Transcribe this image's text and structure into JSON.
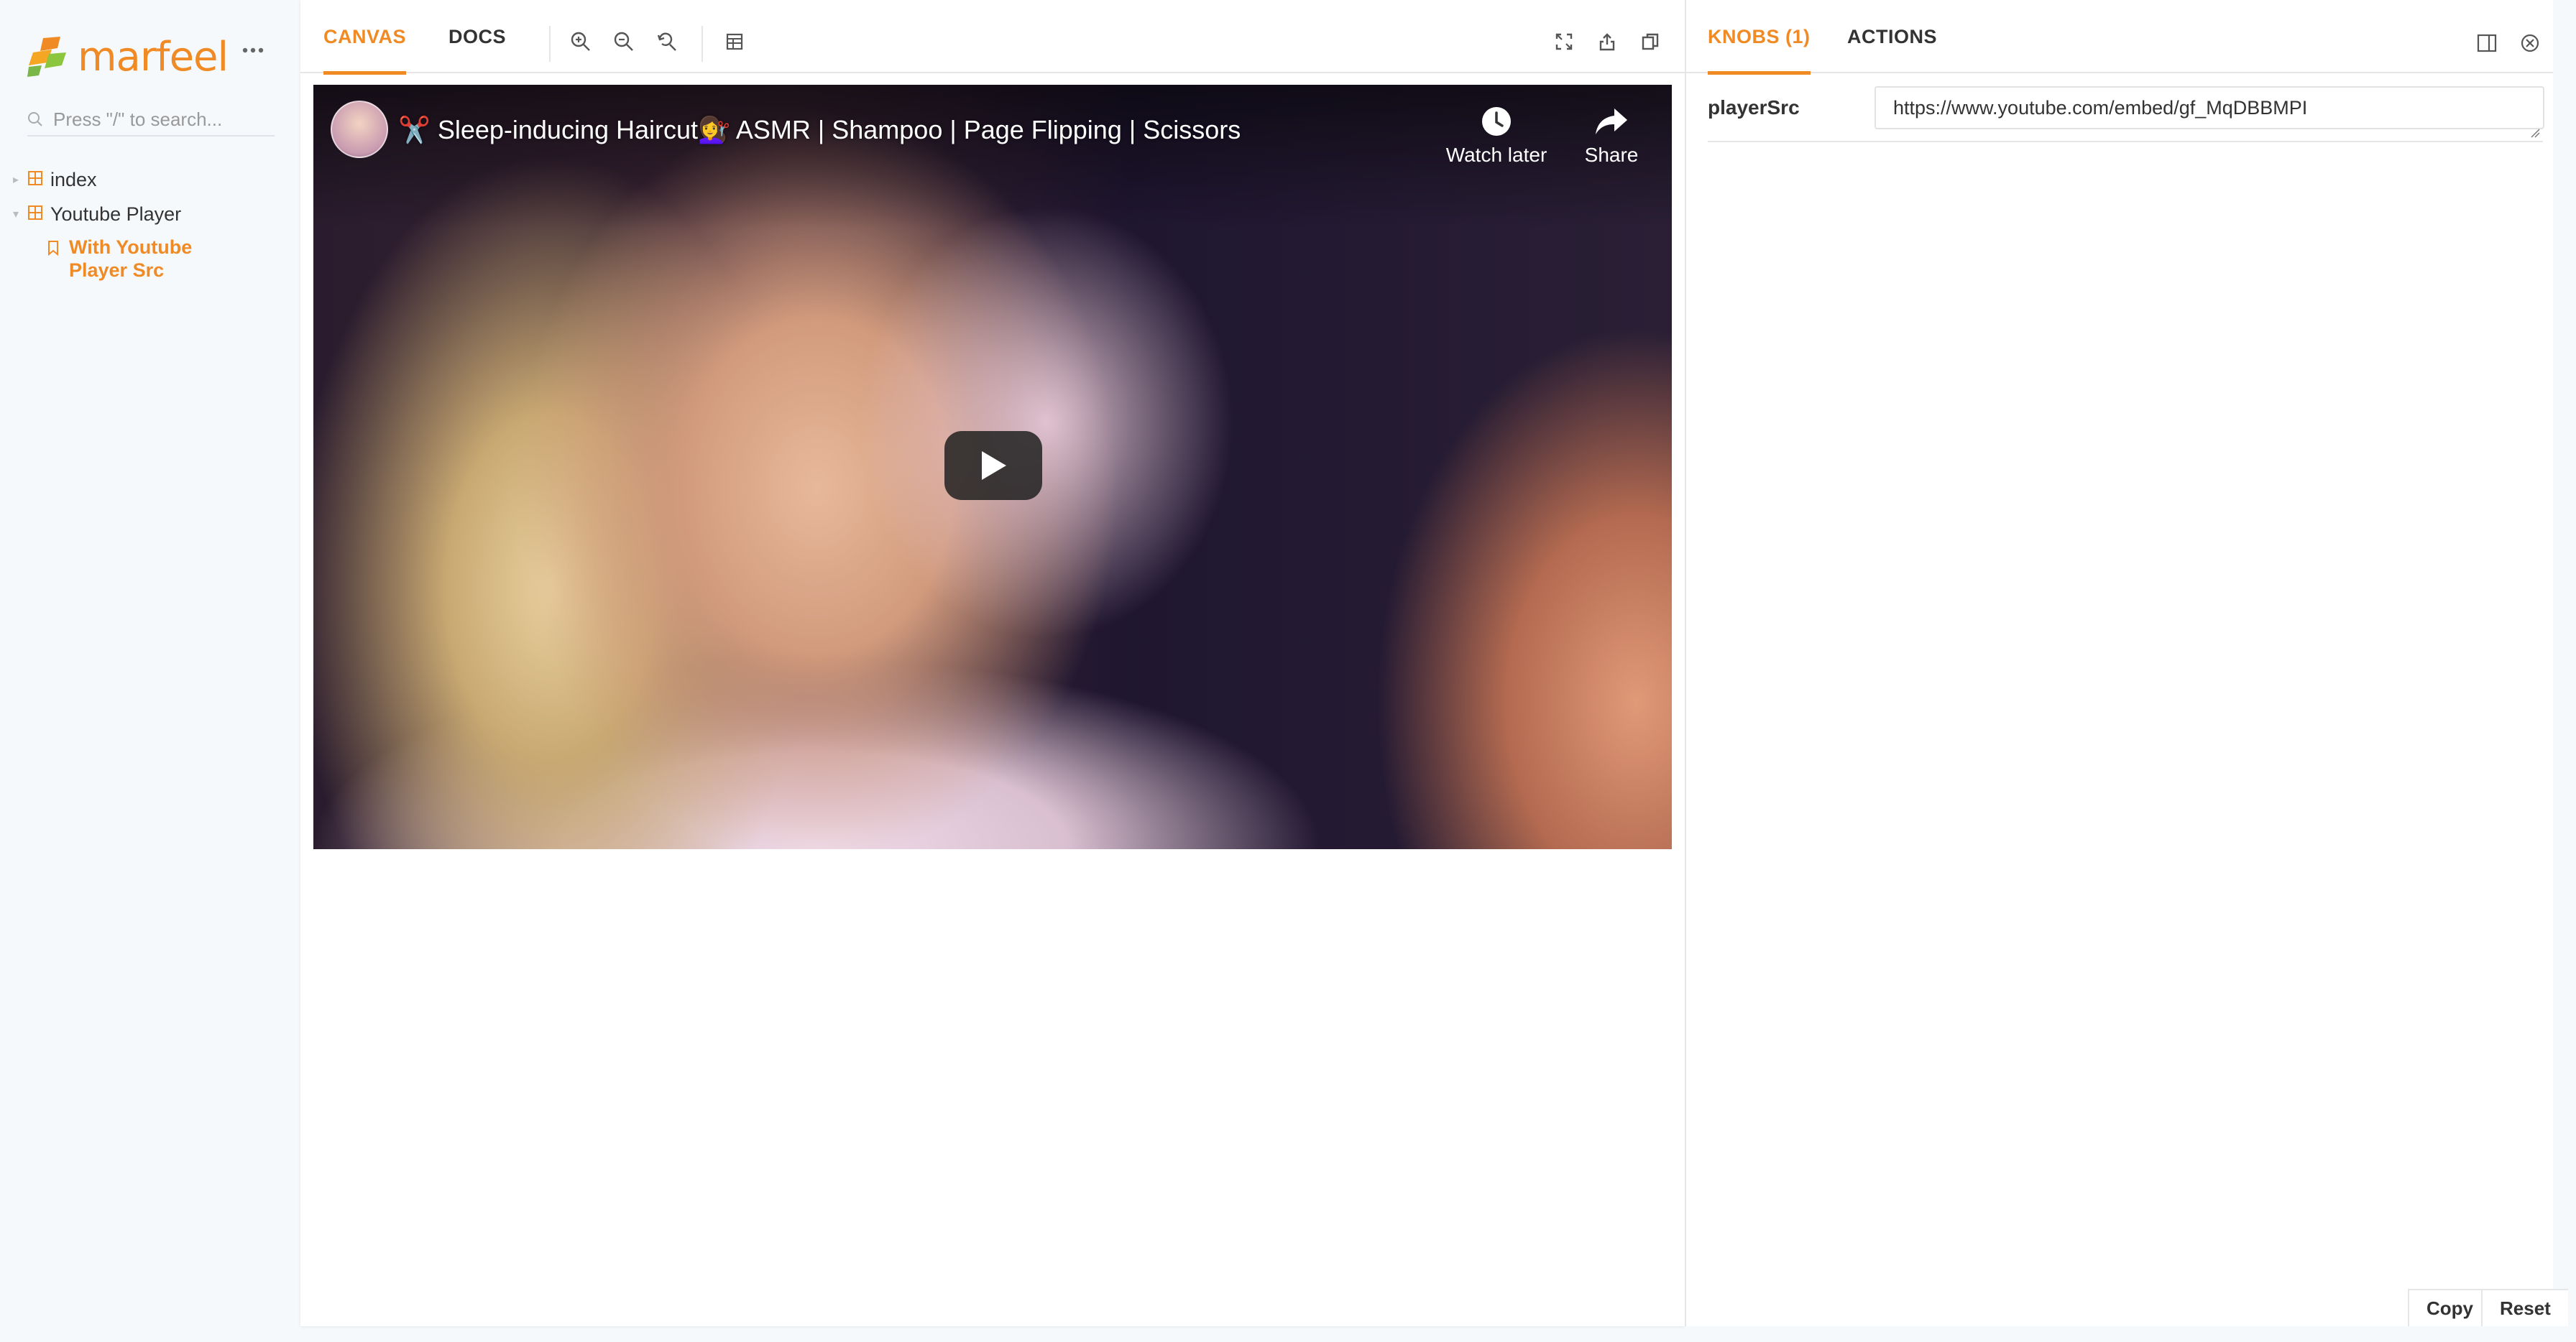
{
  "sidebar": {
    "brand": "marfeel",
    "search_placeholder": "Press \"/\" to search...",
    "tree": [
      {
        "label": "index",
        "expanded": false
      },
      {
        "label": "Youtube Player",
        "expanded": true
      }
    ],
    "active_story": "With Youtube Player Src"
  },
  "toolbar": {
    "tabs": [
      {
        "label": "CANVAS",
        "active": true
      },
      {
        "label": "DOCS",
        "active": false
      }
    ],
    "tools": [
      "zoom-in-icon",
      "zoom-out-icon",
      "zoom-reset-icon",
      "background-grid-icon"
    ],
    "right_tools": [
      "fullscreen-icon",
      "share-icon",
      "copy-link-icon"
    ]
  },
  "video": {
    "title": "✂️ Sleep-inducing Haircut💇‍♀️ ASMR | Shampoo | Page Flipping | Scissors",
    "watch_later_label": "Watch later",
    "share_label": "Share"
  },
  "addons": {
    "tabs": [
      {
        "label": "KNOBS (1)",
        "active": true
      },
      {
        "label": "ACTIONS",
        "active": false
      }
    ],
    "knobs": [
      {
        "name": "playerSrc",
        "value": "https://www.youtube.com/embed/gf_MqDBBMPI"
      }
    ],
    "copy_label": "Copy",
    "reset_label": "Reset"
  },
  "colors": {
    "accent": "#f08a24",
    "sidebar_bg": "#f6f9fc",
    "border": "#e6e6e6",
    "text": "#333333"
  }
}
